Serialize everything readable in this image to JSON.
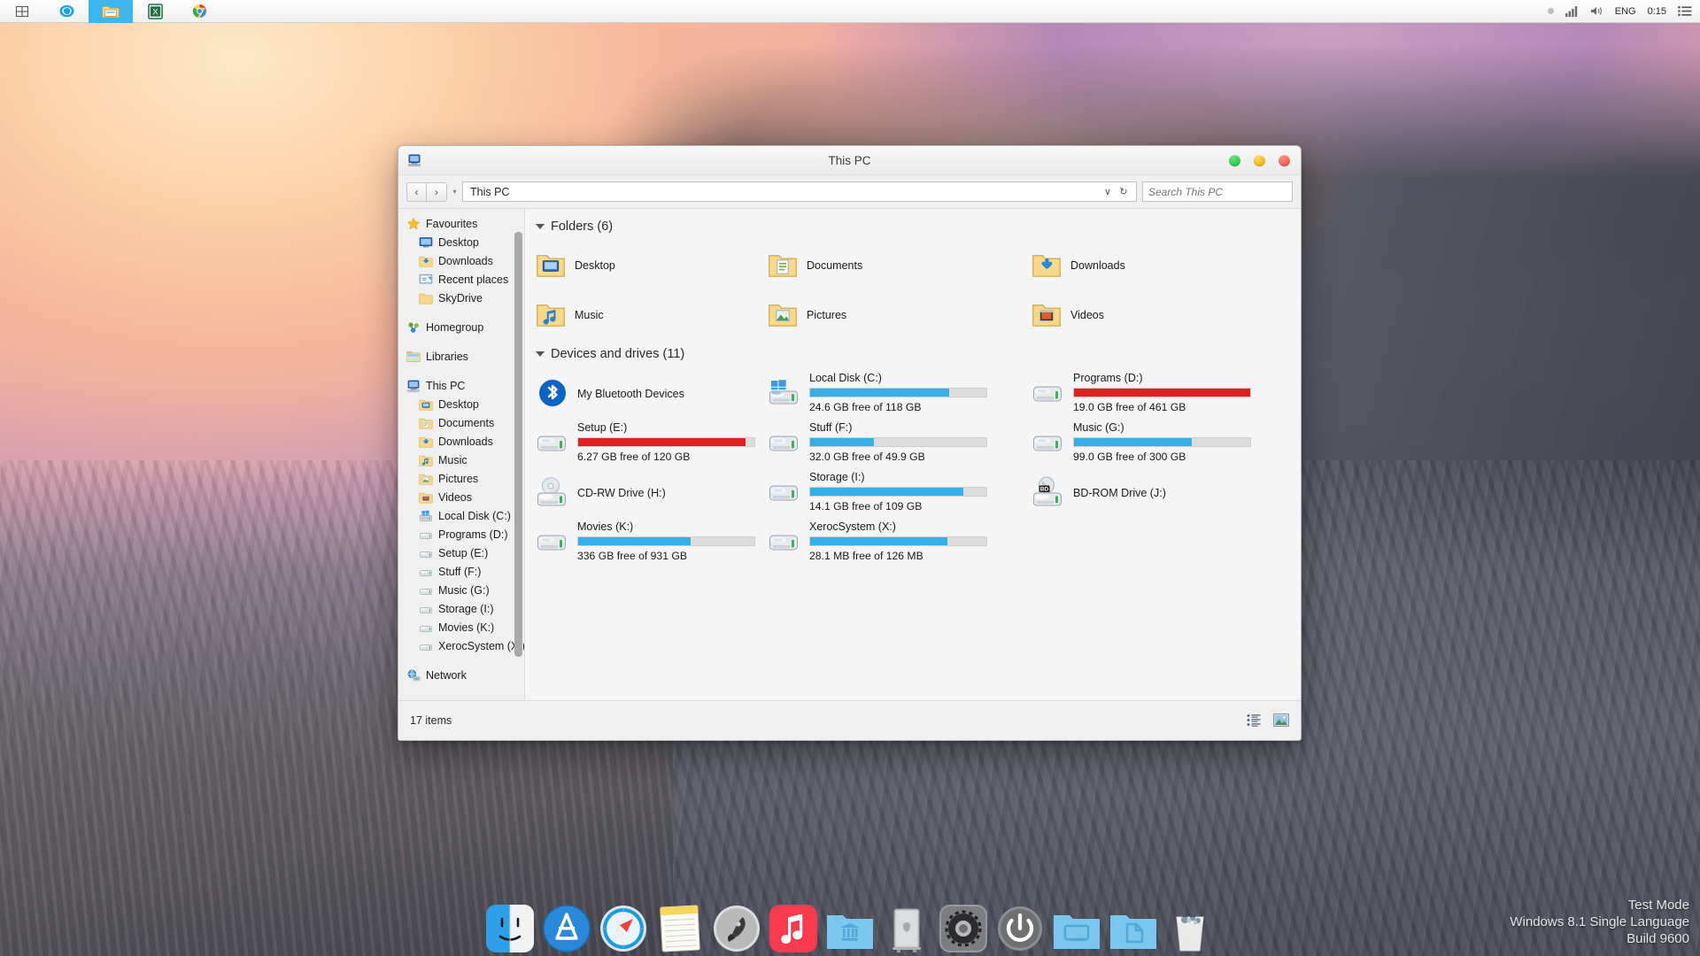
{
  "taskbar": {
    "buttons": [
      {
        "name": "start-button",
        "icon": "windows-logo-icon",
        "active": false
      },
      {
        "name": "internet-explorer-button",
        "icon": "internet-explorer-icon",
        "active": false
      },
      {
        "name": "file-explorer-button",
        "icon": "file-explorer-icon",
        "active": true
      },
      {
        "name": "excel-button",
        "icon": "excel-icon",
        "active": false
      },
      {
        "name": "chrome-button",
        "icon": "chrome-icon",
        "active": false
      }
    ],
    "tray": {
      "hidden_icons": "show-hidden-icons-icon",
      "network": "network-signal-icon",
      "volume": "speaker-icon",
      "language": "ENG",
      "clock": "0:15",
      "action_center": "action-center-icon"
    }
  },
  "window": {
    "title": "This PC",
    "icon": "this-pc-icon",
    "controls": {
      "maximize_color": "#27c93f",
      "minimize_color": "#ffbd2e",
      "close_color": "#ff5f57"
    },
    "toolbar": {
      "back": "‹",
      "forward": "›",
      "recent_caret": "▾",
      "address_value": "This PC",
      "address_caret": "∨",
      "refresh": "↻",
      "search_placeholder": "Search This PC"
    },
    "statusbar": {
      "items_count": "17 items",
      "view_details": "details-view-icon",
      "view_large": "large-icons-view-icon"
    }
  },
  "sidebar": {
    "groups": [
      {
        "name": "Favourites",
        "icon": "star-icon",
        "children": [
          {
            "label": "Desktop",
            "icon": "desktop-icon"
          },
          {
            "label": "Downloads",
            "icon": "downloads-folder-icon"
          },
          {
            "label": "Recent places",
            "icon": "recent-places-icon"
          },
          {
            "label": "SkyDrive",
            "icon": "skydrive-folder-icon"
          }
        ]
      },
      {
        "name": "Homegroup",
        "icon": "homegroup-icon",
        "children": []
      },
      {
        "name": "Libraries",
        "icon": "libraries-icon",
        "children": []
      },
      {
        "name": "This PC",
        "icon": "this-pc-icon",
        "children": [
          {
            "label": "Desktop",
            "icon": "desktop-folder-icon"
          },
          {
            "label": "Documents",
            "icon": "documents-folder-icon"
          },
          {
            "label": "Downloads",
            "icon": "downloads-folder-icon"
          },
          {
            "label": "Music",
            "icon": "music-folder-icon"
          },
          {
            "label": "Pictures",
            "icon": "pictures-folder-icon"
          },
          {
            "label": "Videos",
            "icon": "videos-folder-icon"
          },
          {
            "label": "Local Disk (C:)",
            "icon": "windows-drive-icon"
          },
          {
            "label": "Programs (D:)",
            "icon": "drive-icon"
          },
          {
            "label": "Setup (E:)",
            "icon": "drive-icon"
          },
          {
            "label": "Stuff (F:)",
            "icon": "drive-icon"
          },
          {
            "label": "Music (G:)",
            "icon": "drive-icon"
          },
          {
            "label": "Storage (I:)",
            "icon": "drive-icon"
          },
          {
            "label": "Movies (K:)",
            "icon": "drive-icon"
          },
          {
            "label": "XerocSystem (X:)",
            "icon": "drive-icon"
          }
        ]
      },
      {
        "name": "Network",
        "icon": "network-icon",
        "children": []
      }
    ]
  },
  "main": {
    "folders_group": {
      "label": "Folders (6)",
      "items": [
        {
          "label": "Desktop",
          "icon": "desktop-folder-icon"
        },
        {
          "label": "Documents",
          "icon": "documents-folder-icon"
        },
        {
          "label": "Downloads",
          "icon": "downloads-folder-icon"
        },
        {
          "label": "Music",
          "icon": "music-folder-icon"
        },
        {
          "label": "Pictures",
          "icon": "pictures-folder-icon"
        },
        {
          "label": "Videos",
          "icon": "videos-folder-icon"
        }
      ]
    },
    "drives_group": {
      "label": "Devices and drives (11)",
      "items": [
        {
          "label": "My Bluetooth Devices",
          "icon": "bluetooth-icon",
          "has_bar": false
        },
        {
          "label": "Local Disk (C:)",
          "icon": "windows-drive-icon",
          "has_bar": true,
          "free": "24.6 GB free of 118 GB",
          "used_pct": 79,
          "bar_color": "#36ade4"
        },
        {
          "label": "Programs (D:)",
          "icon": "drive-icon",
          "has_bar": true,
          "free": "19.0 GB free of 461 GB",
          "used_pct": 100,
          "bar_color": "#e02020"
        },
        {
          "label": "Setup (E:)",
          "icon": "drive-icon",
          "has_bar": true,
          "free": "6.27 GB free of 120 GB",
          "used_pct": 95,
          "bar_color": "#e02020"
        },
        {
          "label": "Stuff (F:)",
          "icon": "drive-icon",
          "has_bar": true,
          "free": "32.0 GB free of 49.9 GB",
          "used_pct": 36,
          "bar_color": "#36ade4"
        },
        {
          "label": "Music (G:)",
          "icon": "drive-icon",
          "has_bar": true,
          "free": "99.0 GB free of 300 GB",
          "used_pct": 67,
          "bar_color": "#36ade4"
        },
        {
          "label": "CD-RW Drive (H:)",
          "icon": "cd-rw-drive-icon",
          "has_bar": false
        },
        {
          "label": "Storage (I:)",
          "icon": "drive-icon",
          "has_bar": true,
          "free": "14.1 GB free of 109 GB",
          "used_pct": 87,
          "bar_color": "#36ade4"
        },
        {
          "label": "BD-ROM Drive (J:)",
          "icon": "bd-rom-drive-icon",
          "has_bar": false
        },
        {
          "label": "Movies (K:)",
          "icon": "drive-icon",
          "has_bar": true,
          "free": "336 GB free of 931 GB",
          "used_pct": 64,
          "bar_color": "#36ade4"
        },
        {
          "label": "XerocSystem (X:)",
          "icon": "drive-icon",
          "has_bar": true,
          "free": "28.1 MB free of 126 MB",
          "used_pct": 78,
          "bar_color": "#36ade4"
        }
      ]
    }
  },
  "dock": {
    "items": [
      {
        "name": "finder",
        "icon": "finder-icon"
      },
      {
        "name": "app-store",
        "icon": "app-store-icon"
      },
      {
        "name": "safari",
        "icon": "safari-icon"
      },
      {
        "name": "notes",
        "icon": "notes-icon"
      },
      {
        "name": "launchpad",
        "icon": "launchpad-icon"
      },
      {
        "name": "itunes",
        "icon": "itunes-icon"
      },
      {
        "name": "documents-folder",
        "icon": "blue-folder-bank-icon"
      },
      {
        "name": "mac-pro",
        "icon": "mac-pro-icon"
      },
      {
        "name": "system-preferences",
        "icon": "gear-icon"
      },
      {
        "name": "shutdown",
        "icon": "power-icon"
      },
      {
        "name": "downloads-folder",
        "icon": "blue-folder-window-icon"
      },
      {
        "name": "files-folder",
        "icon": "blue-folder-document-icon"
      },
      {
        "name": "trash",
        "icon": "trash-icon"
      }
    ]
  },
  "watermark": {
    "line1": "Test Mode",
    "line2": "Windows 8.1 Single Language",
    "line3": "Build 9600"
  }
}
